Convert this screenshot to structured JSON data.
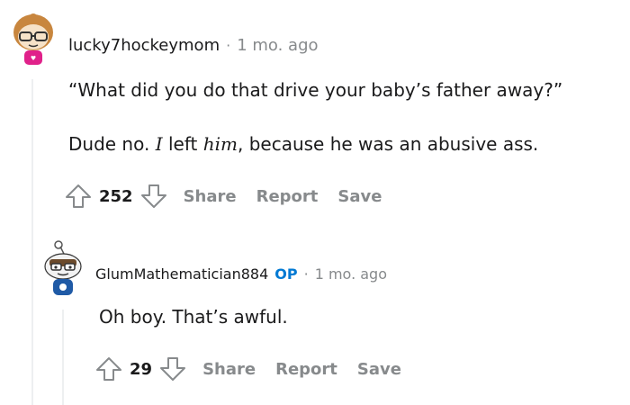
{
  "comments": [
    {
      "username": "lucky7hockeymom",
      "separator": "·",
      "time": "1 mo. ago",
      "lines": [
        "“What did you do that drive your baby’s father away?”"
      ],
      "line2": {
        "part1": "Dude no. ",
        "italic1": "I",
        "part2": " left ",
        "italic2": "him",
        "part3": ", because he was an abusive ass."
      },
      "votes": "252",
      "actions": {
        "share": "Share",
        "report": "Report",
        "save": "Save"
      }
    },
    {
      "username": "GlumMathematician884",
      "op_badge": "OP",
      "separator": "·",
      "time": "1 mo. ago",
      "text": "Oh boy. That’s awful.",
      "votes": "29",
      "actions": {
        "share": "Share",
        "report": "Report",
        "save": "Save"
      }
    }
  ],
  "colors": {
    "text": "#1a1a1b",
    "muted": "#878a8c",
    "op": "#0079d3",
    "thread_line": "#edeff1"
  },
  "icons": [
    "avatar-glasses-girl",
    "avatar-snoo-op",
    "upvote-icon",
    "downvote-icon"
  ]
}
